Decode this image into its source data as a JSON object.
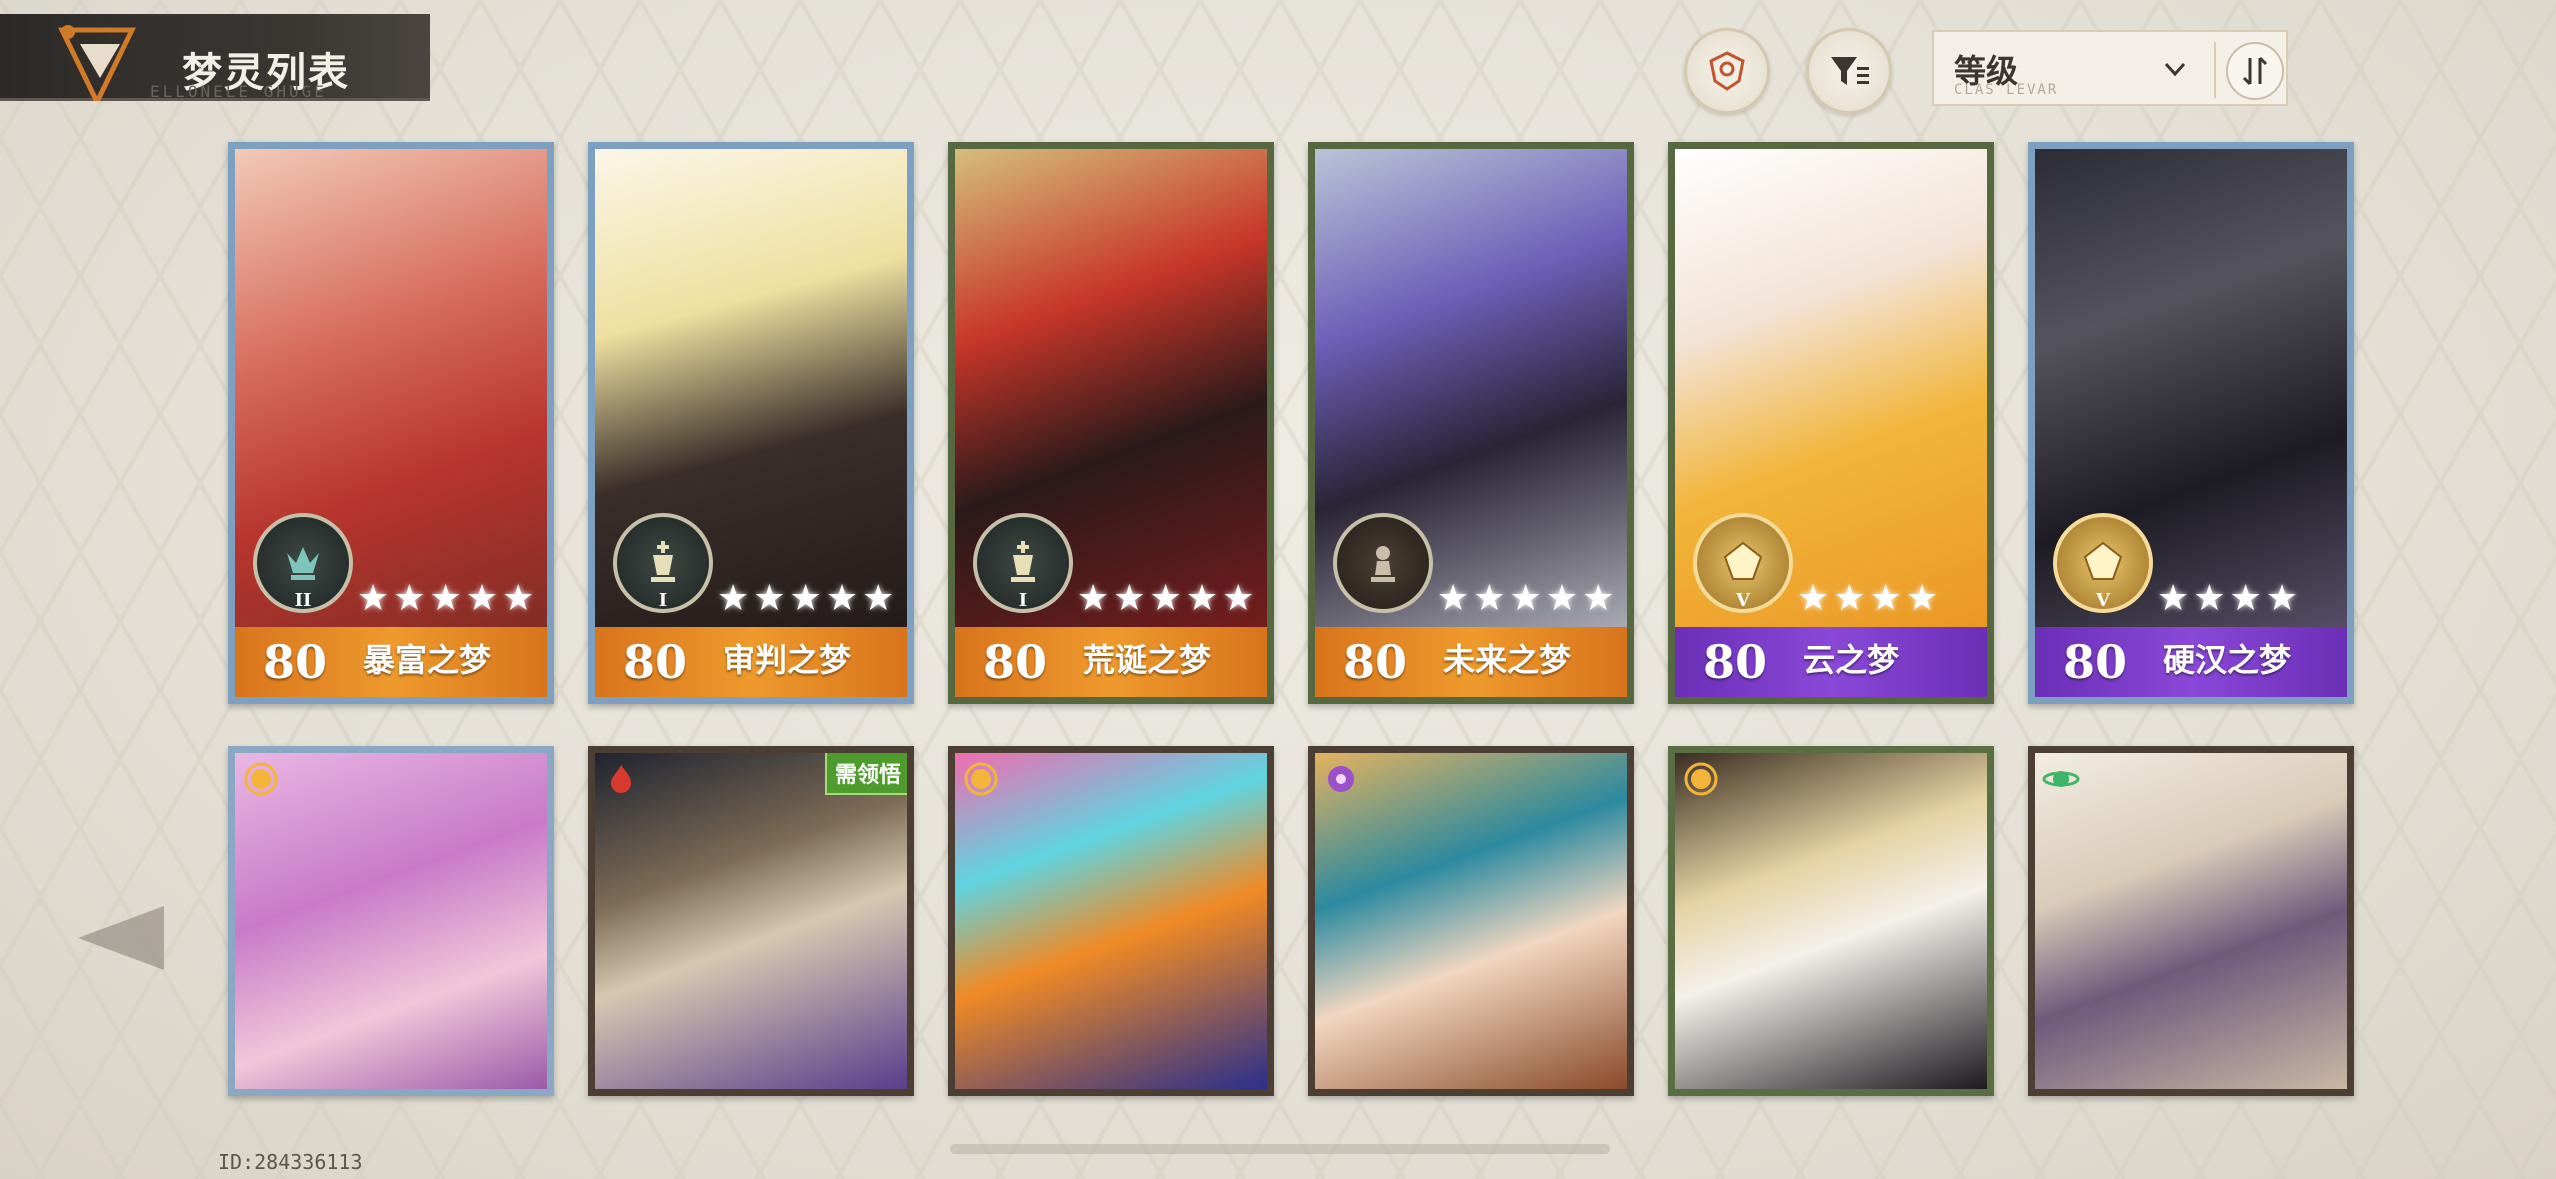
{
  "header": {
    "title": "梦灵列表",
    "subtitle": "ELLONELE GHUGE"
  },
  "toolbar": {
    "icon_button_1": "profile-badge-icon",
    "icon_button_2": "filter-icon",
    "sort": {
      "label": "等级",
      "sublabel": "CLAS LEVAR"
    }
  },
  "top_cards": [
    {
      "level": "80",
      "name": "暴富之梦",
      "stars": "★★★★★",
      "rank": "II",
      "footer": "orange"
    },
    {
      "level": "80",
      "name": "审判之梦",
      "stars": "★★★★★",
      "rank": "I",
      "footer": "orange"
    },
    {
      "level": "80",
      "name": "荒诞之梦",
      "stars": "★★★★★",
      "rank": "I",
      "footer": "orange"
    },
    {
      "level": "80",
      "name": "未来之梦",
      "stars": "★★★★★",
      "rank": "",
      "footer": "orange"
    },
    {
      "level": "80",
      "name": "云之梦",
      "stars": "★★★★",
      "rank": "V",
      "footer": "purple"
    },
    {
      "level": "80",
      "name": "硬汉之梦",
      "stars": "★★★★",
      "rank": "V",
      "footer": "purple"
    }
  ],
  "bottom_cards": [
    {
      "tag": ""
    },
    {
      "tag": "需领悟"
    },
    {
      "tag": ""
    },
    {
      "tag": ""
    },
    {
      "tag": ""
    },
    {
      "tag": ""
    }
  ],
  "footer": {
    "id_text": "ID:284336113"
  }
}
